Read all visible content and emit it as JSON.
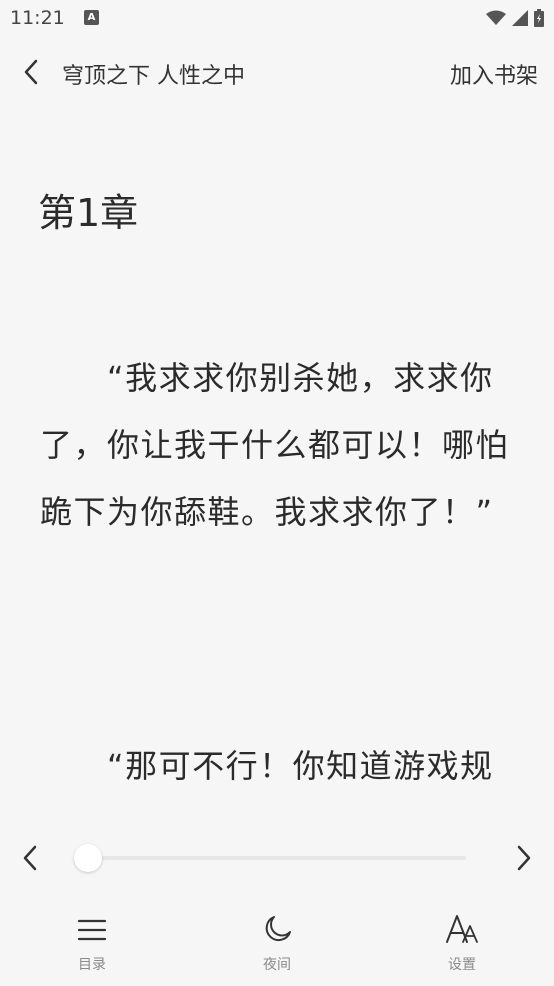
{
  "status": {
    "time": "11:21",
    "app_badge": "A"
  },
  "header": {
    "book_title": "穹顶之下 人性之中",
    "add_to_shelf": "加入书架"
  },
  "content": {
    "chapter_title": "第1章",
    "paragraph_1": "　　“我求求你别杀她，求求你了，你让我干什么都可以！哪怕跪下为你舔鞋。我求求你了！”",
    "paragraph_2": "　　“那可不行！你知道游戏规"
  },
  "progress": {
    "fraction": 0.0
  },
  "bottom_nav": {
    "toc": "目录",
    "night": "夜间",
    "settings": "设置"
  }
}
